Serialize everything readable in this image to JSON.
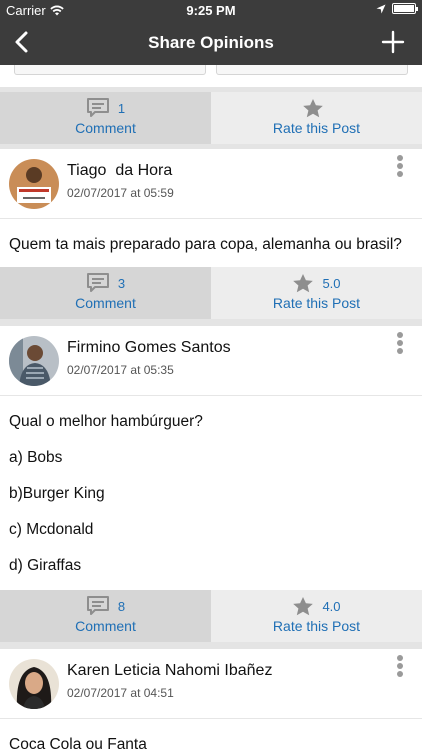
{
  "status_bar": {
    "carrier": "Carrier",
    "time": "9:25 PM"
  },
  "nav": {
    "title": "Share Opinions",
    "back_icon": "chevron-left-icon",
    "add_icon": "plus-icon"
  },
  "colors": {
    "bar": "#3c3c3c",
    "accent": "#1f6fb5",
    "star": "#8e8e8e"
  },
  "action_labels": {
    "comment": "Comment",
    "rate": "Rate this Post"
  },
  "top_actions": {
    "comment_count": "1",
    "rating": ""
  },
  "posts": [
    {
      "author": "Tiago  da Hora",
      "date": "02/07/2017 at 05:59",
      "lines": [
        "Quem ta mais preparado para copa, alemanha ou brasil?"
      ],
      "comment_count": "3",
      "rating": "5.0"
    },
    {
      "author": "Firmino Gomes Santos",
      "date": "02/07/2017 at 05:35",
      "lines": [
        "Qual o melhor hambúrguer?",
        "a) Bobs",
        "b)Burger King",
        "c) Mcdonald",
        "d) Giraffas"
      ],
      "comment_count": "8",
      "rating": "4.0"
    },
    {
      "author": "Karen Leticia Nahomi Ibañez",
      "date": "02/07/2017 at 04:51",
      "lines": [
        "Coca Cola ou Fanta"
      ],
      "comment_count": "",
      "rating": ""
    }
  ]
}
